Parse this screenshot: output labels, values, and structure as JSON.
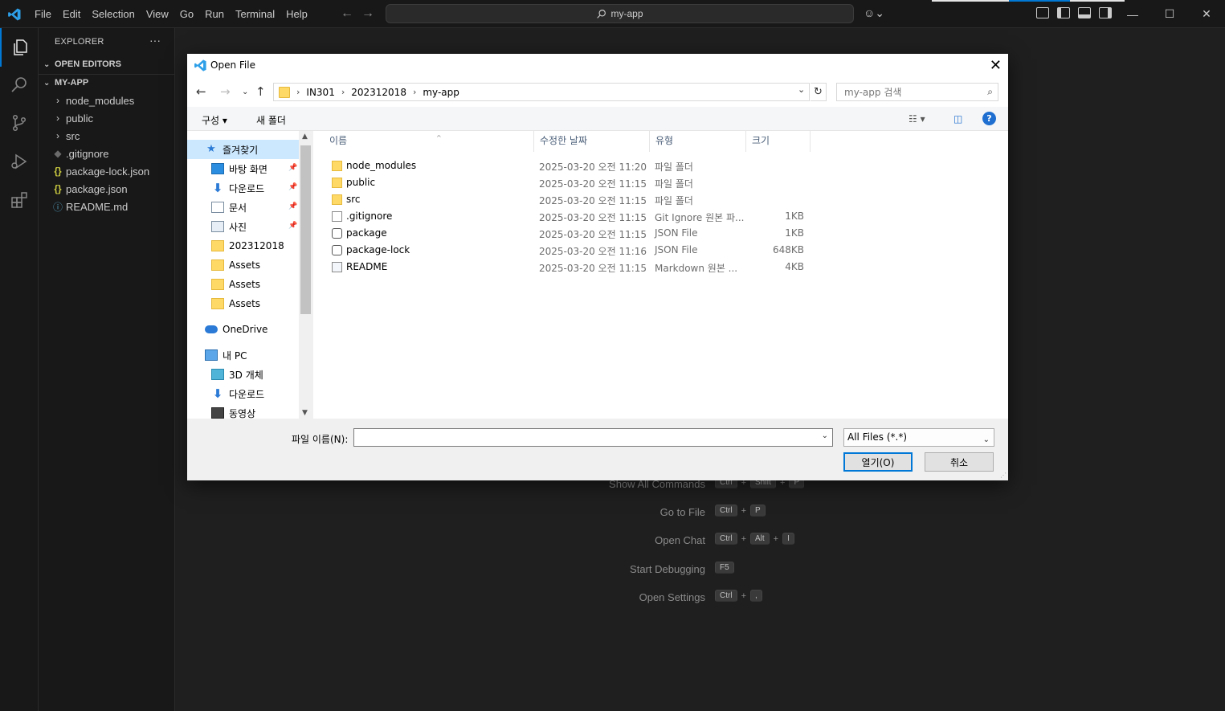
{
  "window": {
    "menu": [
      "File",
      "Edit",
      "Selection",
      "View",
      "Go",
      "Run",
      "Terminal",
      "Help"
    ],
    "command_center": "my-app"
  },
  "sidebar": {
    "title": "EXPLORER",
    "open_editors": "OPEN EDITORS",
    "project": "MY-APP",
    "items": [
      {
        "label": "node_modules",
        "icon": "chevron-right-icon"
      },
      {
        "label": "public",
        "icon": "chevron-right-icon"
      },
      {
        "label": "src",
        "icon": "chevron-right-icon"
      },
      {
        "label": ".gitignore",
        "icon": "git-icon"
      },
      {
        "label": "package-lock.json",
        "icon": "json-icon"
      },
      {
        "label": "package.json",
        "icon": "json-icon"
      },
      {
        "label": "README.md",
        "icon": "info-icon"
      }
    ]
  },
  "shortcuts": [
    {
      "label": "Show All Commands",
      "keys": [
        "Ctrl",
        "Shift",
        "P"
      ]
    },
    {
      "label": "Go to File",
      "keys": [
        "Ctrl",
        "P"
      ]
    },
    {
      "label": "Open Chat",
      "keys": [
        "Ctrl",
        "Alt",
        "I"
      ]
    },
    {
      "label": "Start Debugging",
      "keys": [
        "F5"
      ]
    },
    {
      "label": "Open Settings",
      "keys": [
        "Ctrl",
        ","
      ]
    }
  ],
  "dialog": {
    "title": "Open File",
    "breadcrumbs": [
      "IN301",
      "202312018",
      "my-app"
    ],
    "search_placeholder": "my-app 검색",
    "organize": "구성 ▾",
    "new_folder": "새 폴더",
    "nav_items": [
      {
        "label": "즐겨찾기",
        "icon": "star-icon",
        "selected": true
      },
      {
        "label": "바탕 화면",
        "icon": "desktop-icon",
        "pinned": true
      },
      {
        "label": "다운로드",
        "icon": "download-icon",
        "pinned": true
      },
      {
        "label": "문서",
        "icon": "document-icon",
        "pinned": true
      },
      {
        "label": "사진",
        "icon": "picture-icon",
        "pinned": true
      },
      {
        "label": "202312018",
        "icon": "folder-icon"
      },
      {
        "label": "Assets",
        "icon": "folder-icon"
      },
      {
        "label": "Assets",
        "icon": "folder-icon"
      },
      {
        "label": "Assets",
        "icon": "folder-icon"
      },
      {
        "label": "OneDrive",
        "icon": "cloud-icon"
      },
      {
        "label": "내 PC",
        "icon": "pc-icon"
      },
      {
        "label": "3D 개체",
        "icon": "cube-icon"
      },
      {
        "label": "다운로드",
        "icon": "download-icon"
      },
      {
        "label": "동영상",
        "icon": "video-icon"
      }
    ],
    "columns": [
      "이름",
      "수정한 날짜",
      "유형",
      "크기"
    ],
    "files": [
      {
        "name": "node_modules",
        "date": "2025-03-20 오전 11:20",
        "type": "파일 폴더",
        "size": "",
        "icon": "folder-icon"
      },
      {
        "name": "public",
        "date": "2025-03-20 오전 11:15",
        "type": "파일 폴더",
        "size": "",
        "icon": "folder-icon"
      },
      {
        "name": "src",
        "date": "2025-03-20 오전 11:15",
        "type": "파일 폴더",
        "size": "",
        "icon": "folder-icon"
      },
      {
        "name": ".gitignore",
        "date": "2025-03-20 오전 11:15",
        "type": "Git Ignore 원본 파...",
        "size": "1KB",
        "icon": "gear-file-icon"
      },
      {
        "name": "package",
        "date": "2025-03-20 오전 11:15",
        "type": "JSON File",
        "size": "1KB",
        "icon": "json-file-icon"
      },
      {
        "name": "package-lock",
        "date": "2025-03-20 오전 11:16",
        "type": "JSON File",
        "size": "648KB",
        "icon": "json-file-icon"
      },
      {
        "name": "README",
        "date": "2025-03-20 오전 11:15",
        "type": "Markdown 원본 ...",
        "size": "4KB",
        "icon": "markdown-file-icon"
      }
    ],
    "filename_label": "파일 이름(N):",
    "filename_value": "",
    "filetype": "All Files (*.*)",
    "open_button": "열기(O)",
    "cancel_button": "취소"
  }
}
